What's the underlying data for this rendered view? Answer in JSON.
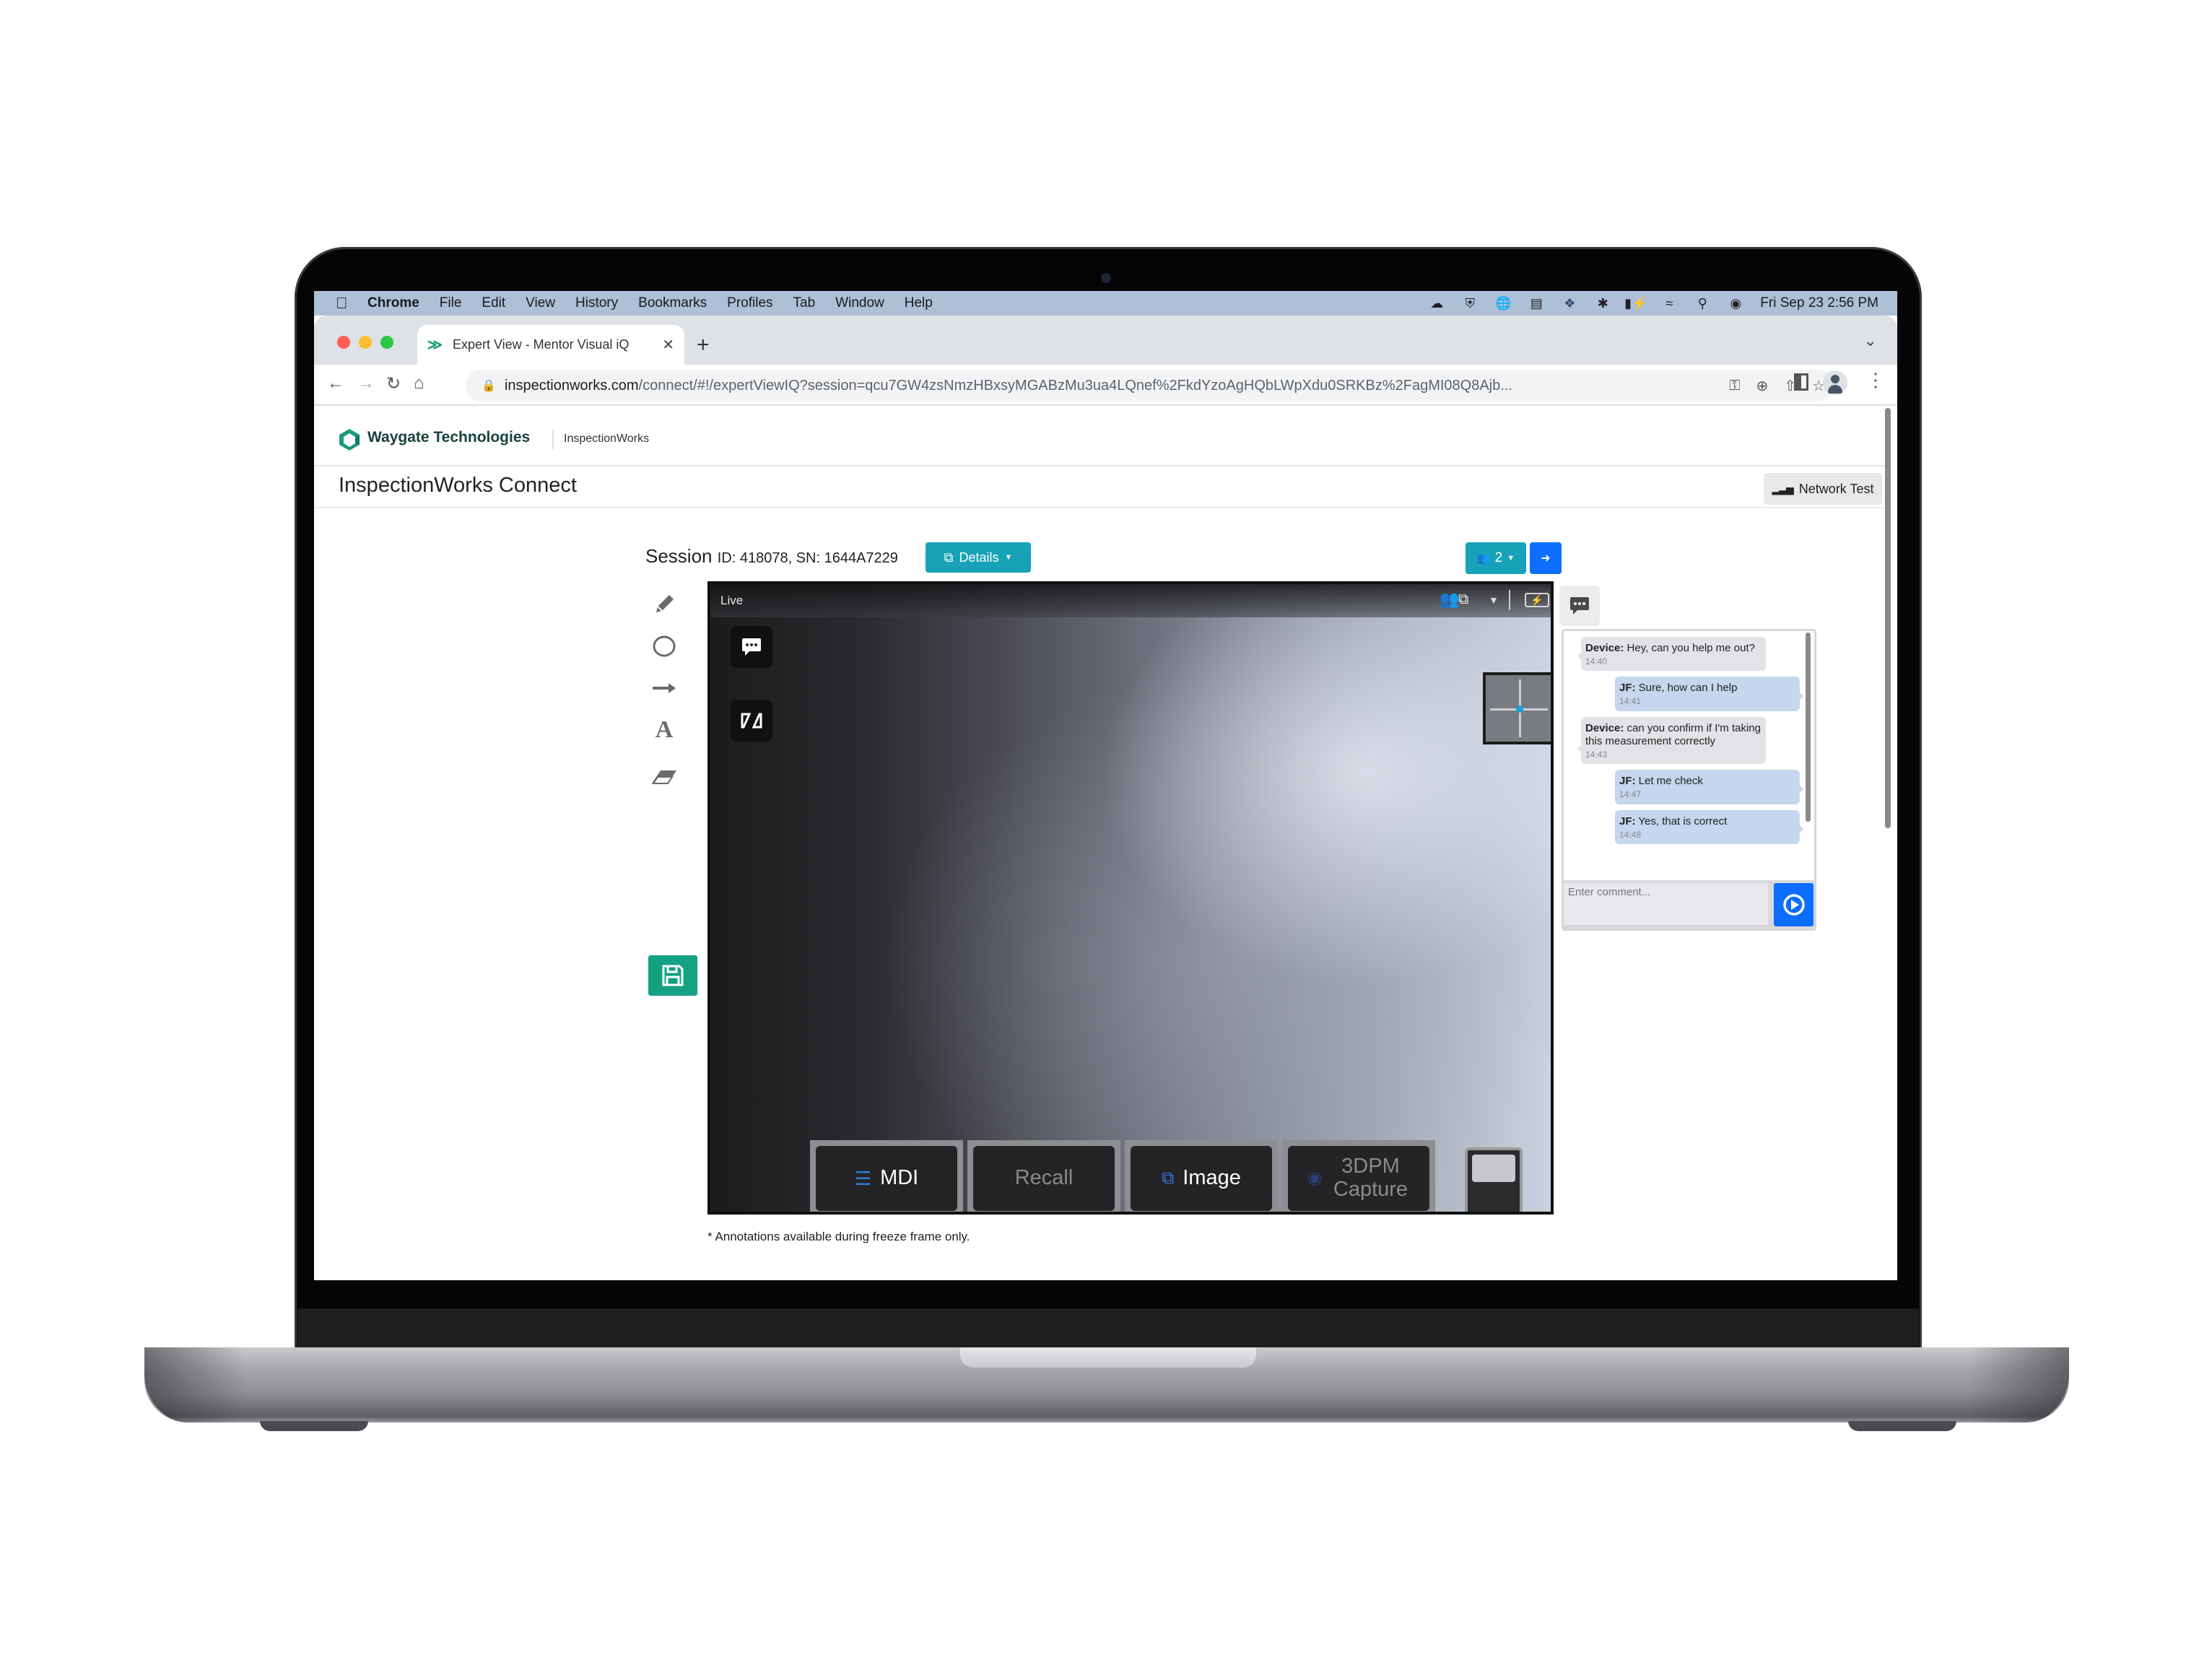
{
  "menubar": {
    "app_name": "Chrome",
    "items": [
      "File",
      "Edit",
      "View",
      "History",
      "Bookmarks",
      "Profiles",
      "Tab",
      "Window",
      "Help"
    ],
    "datetime": "Fri Sep 23  2:56 PM"
  },
  "browser": {
    "tab_title": "Expert View - Mentor Visual iQ",
    "new_tab_label": "+",
    "url_host": "inspectionworks.com",
    "url_path": "/connect/#!/expertViewIQ?session=qcu7GW4zsNmzHBxsyMGABzMu3ua4LQnef%2FkdYzoAgHQbLWpXdu0SRKBz%2FagMI08Q8Ajb..."
  },
  "header": {
    "brand": "Waygate Technologies",
    "product": "InspectionWorks",
    "app_title": "InspectionWorks Connect",
    "network_test_label": "Network Test"
  },
  "session": {
    "label": "Session",
    "meta": "ID: 418078, SN: 1644A7229",
    "details_label": "Details",
    "participants_count": "2"
  },
  "video": {
    "status": "Live",
    "buttons": [
      {
        "label": "MDI",
        "enabled": true
      },
      {
        "label": "Recall",
        "enabled": false
      },
      {
        "label": "Image",
        "enabled": true
      },
      {
        "label": "3DPM Capture",
        "enabled": false
      }
    ],
    "note": "* Annotations available during freeze frame only."
  },
  "chat": {
    "messages": [
      {
        "sender": "Device:",
        "text": " Hey, can you help me out?",
        "time": "14:40",
        "side": "device"
      },
      {
        "sender": "JF:",
        "text": " Sure, how can I help",
        "time": "14:41",
        "side": "me"
      },
      {
        "sender": "Device:",
        "text": " can you confirm if I'm taking this measurement correctly",
        "time": "14:43",
        "side": "device"
      },
      {
        "sender": "JF:",
        "text": " Let me check",
        "time": "14:47",
        "side": "me"
      },
      {
        "sender": "JF:",
        "text": " Yes, that is correct",
        "time": "14:48",
        "side": "me"
      }
    ],
    "input_placeholder": "Enter comment..."
  },
  "colors": {
    "teal_button": "#17a2b8",
    "primary_blue": "#0d6efd",
    "save_green": "#13a182",
    "menubar_bg": "#aebfd8"
  }
}
